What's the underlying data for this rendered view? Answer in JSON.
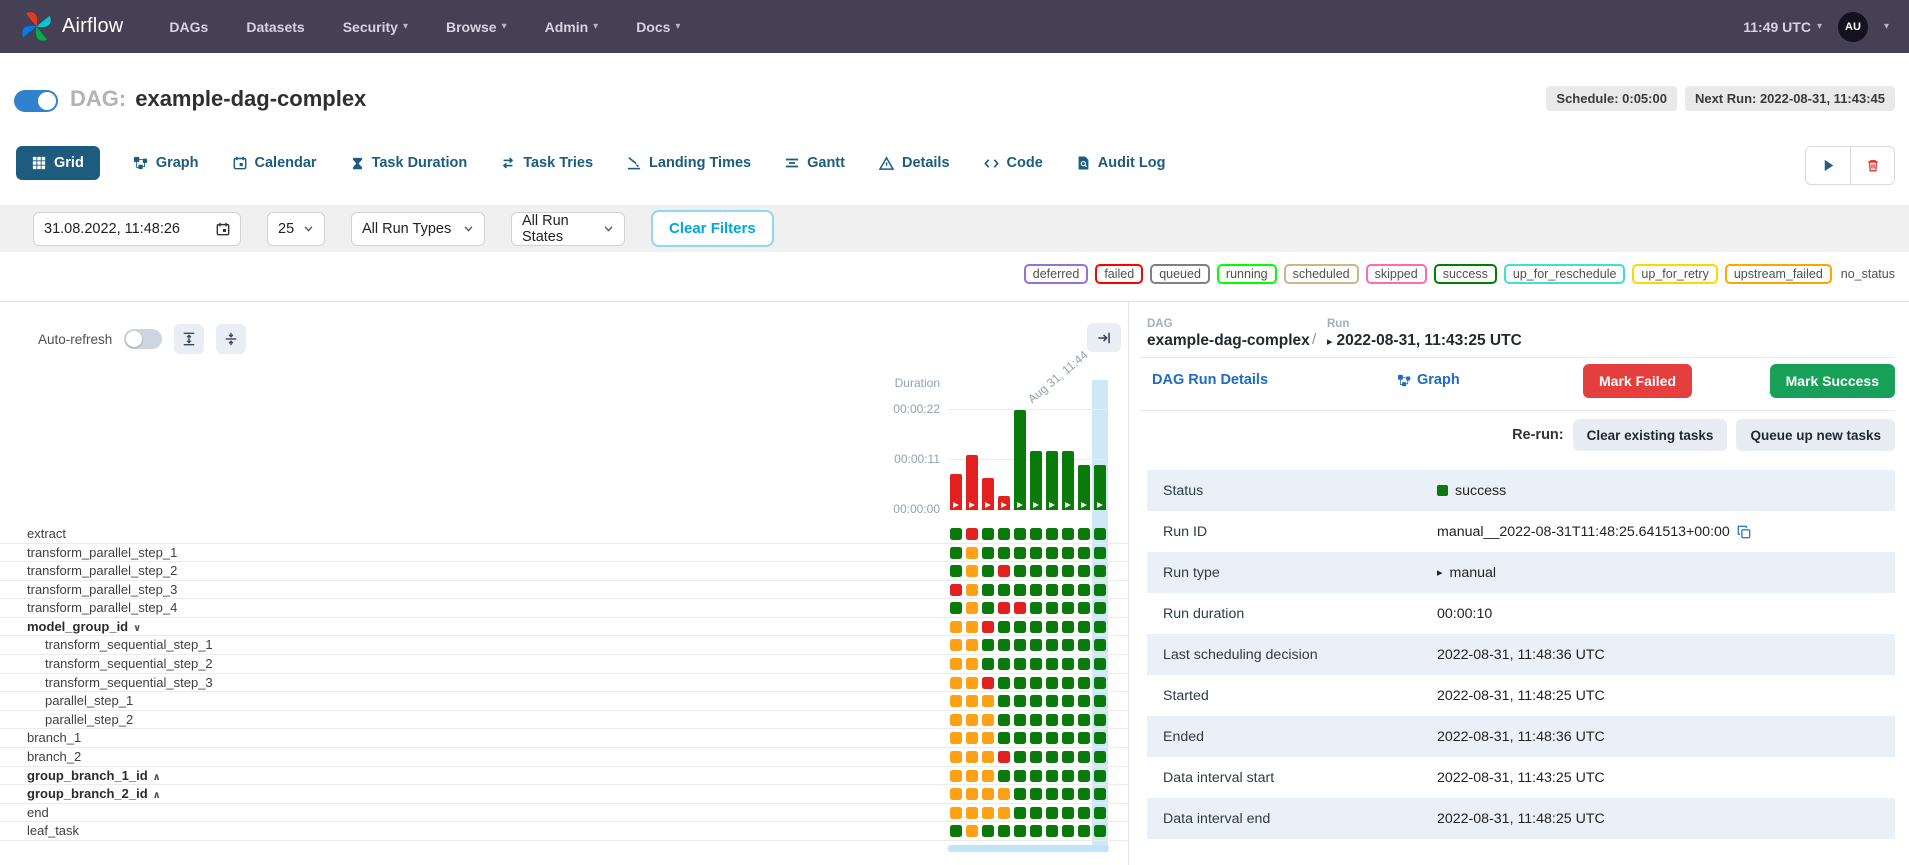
{
  "navbar": {
    "brand": "Airflow",
    "items": [
      {
        "label": "DAGs",
        "dropdown": false
      },
      {
        "label": "Datasets",
        "dropdown": false
      },
      {
        "label": "Security",
        "dropdown": true
      },
      {
        "label": "Browse",
        "dropdown": true
      },
      {
        "label": "Admin",
        "dropdown": true
      },
      {
        "label": "Docs",
        "dropdown": true
      }
    ],
    "clock": "11:49 UTC",
    "avatar_initials": "AU"
  },
  "header": {
    "dag_prefix": "DAG:",
    "dag_title": "example-dag-complex",
    "schedule_badge": "Schedule: 0:05:00",
    "next_run_badge": "Next Run: 2022-08-31, 11:43:45",
    "dag_enabled": true
  },
  "tabs": [
    {
      "label": "Grid",
      "icon": "grid-icon",
      "active": true
    },
    {
      "label": "Graph",
      "icon": "graph-icon",
      "active": false
    },
    {
      "label": "Calendar",
      "icon": "calendar-icon",
      "active": false
    },
    {
      "label": "Task Duration",
      "icon": "hourglass-icon",
      "active": false
    },
    {
      "label": "Task Tries",
      "icon": "retry-icon",
      "active": false
    },
    {
      "label": "Landing Times",
      "icon": "landing-icon",
      "active": false
    },
    {
      "label": "Gantt",
      "icon": "gantt-icon",
      "active": false
    },
    {
      "label": "Details",
      "icon": "details-icon",
      "active": false
    },
    {
      "label": "Code",
      "icon": "code-icon",
      "active": false
    },
    {
      "label": "Audit Log",
      "icon": "audit-icon",
      "active": false
    }
  ],
  "toolbar": {
    "run_icon": "play-icon",
    "delete_icon": "trash-icon"
  },
  "filters": {
    "base_date": "31.08.2022, 11:48:26",
    "num_runs": "25",
    "run_type": "All Run Types",
    "run_state": "All Run States",
    "clear_label": "Clear Filters"
  },
  "legend": {
    "items": [
      {
        "label": "deferred",
        "color": "#9370DB"
      },
      {
        "label": "failed",
        "color": "#FF0000"
      },
      {
        "label": "queued",
        "color": "#808080"
      },
      {
        "label": "running",
        "color": "#00FF00"
      },
      {
        "label": "scheduled",
        "color": "#D2B48C"
      },
      {
        "label": "skipped",
        "color": "#FF69B4"
      },
      {
        "label": "success",
        "color": "#008000"
      },
      {
        "label": "up_for_reschedule",
        "color": "#40E0D0"
      },
      {
        "label": "up_for_retry",
        "color": "#FFD700"
      },
      {
        "label": "upstream_failed",
        "color": "#FFA500"
      },
      {
        "label": "no_status",
        "color": null
      }
    ]
  },
  "grid_panel": {
    "auto_refresh_label": "Auto-refresh",
    "selected_run_index": 9
  },
  "chart_data": {
    "type": "bar",
    "title": "Duration",
    "ylabel": "Duration",
    "yticks": [
      "00:00:00",
      "00:00:11",
      "00:00:22"
    ],
    "ylim_seconds": [
      0,
      22
    ],
    "x_axis_label": "Aug 31, 11:44",
    "runs": [
      {
        "duration_seconds": 8,
        "state": "failed"
      },
      {
        "duration_seconds": 12,
        "state": "failed"
      },
      {
        "duration_seconds": 7,
        "state": "failed"
      },
      {
        "duration_seconds": 3,
        "state": "failed"
      },
      {
        "duration_seconds": 22,
        "state": "success"
      },
      {
        "duration_seconds": 13,
        "state": "success"
      },
      {
        "duration_seconds": 13,
        "state": "success"
      },
      {
        "duration_seconds": 13,
        "state": "success"
      },
      {
        "duration_seconds": 10,
        "state": "success"
      },
      {
        "duration_seconds": 10,
        "state": "success"
      }
    ]
  },
  "state_colors": {
    "success": "#0a7a0a",
    "failed": "#e32020",
    "upstream_failed": "#ffa115"
  },
  "tasks": [
    {
      "name": "extract",
      "indent": false,
      "group": null,
      "states": [
        "success",
        "failed",
        "success",
        "success",
        "success",
        "success",
        "success",
        "success",
        "success",
        "success"
      ]
    },
    {
      "name": "transform_parallel_step_1",
      "indent": false,
      "group": null,
      "states": [
        "success",
        "upstream_failed",
        "success",
        "success",
        "success",
        "success",
        "success",
        "success",
        "success",
        "success"
      ]
    },
    {
      "name": "transform_parallel_step_2",
      "indent": false,
      "group": null,
      "states": [
        "success",
        "upstream_failed",
        "success",
        "failed",
        "success",
        "success",
        "success",
        "success",
        "success",
        "success"
      ]
    },
    {
      "name": "transform_parallel_step_3",
      "indent": false,
      "group": null,
      "states": [
        "failed",
        "upstream_failed",
        "success",
        "success",
        "success",
        "success",
        "success",
        "success",
        "success",
        "success"
      ]
    },
    {
      "name": "transform_parallel_step_4",
      "indent": false,
      "group": null,
      "states": [
        "success",
        "upstream_failed",
        "success",
        "failed",
        "failed",
        "success",
        "success",
        "success",
        "success",
        "success"
      ]
    },
    {
      "name": "model_group_id",
      "indent": false,
      "group": "expanded",
      "states": [
        "upstream_failed",
        "upstream_failed",
        "failed",
        "success",
        "success",
        "success",
        "success",
        "success",
        "success",
        "success"
      ]
    },
    {
      "name": "transform_sequential_step_1",
      "indent": true,
      "group": null,
      "states": [
        "upstream_failed",
        "upstream_failed",
        "success",
        "success",
        "success",
        "success",
        "success",
        "success",
        "success",
        "success"
      ]
    },
    {
      "name": "transform_sequential_step_2",
      "indent": true,
      "group": null,
      "states": [
        "upstream_failed",
        "upstream_failed",
        "success",
        "success",
        "success",
        "success",
        "success",
        "success",
        "success",
        "success"
      ]
    },
    {
      "name": "transform_sequential_step_3",
      "indent": true,
      "group": null,
      "states": [
        "upstream_failed",
        "upstream_failed",
        "failed",
        "success",
        "success",
        "success",
        "success",
        "success",
        "success",
        "success"
      ]
    },
    {
      "name": "parallel_step_1",
      "indent": true,
      "group": null,
      "states": [
        "upstream_failed",
        "upstream_failed",
        "upstream_failed",
        "success",
        "success",
        "success",
        "success",
        "success",
        "success",
        "success"
      ]
    },
    {
      "name": "parallel_step_2",
      "indent": true,
      "group": null,
      "states": [
        "upstream_failed",
        "upstream_failed",
        "upstream_failed",
        "success",
        "success",
        "success",
        "success",
        "success",
        "success",
        "success"
      ]
    },
    {
      "name": "branch_1",
      "indent": false,
      "group": null,
      "states": [
        "upstream_failed",
        "upstream_failed",
        "upstream_failed",
        "success",
        "success",
        "success",
        "success",
        "success",
        "success",
        "success"
      ]
    },
    {
      "name": "branch_2",
      "indent": false,
      "group": null,
      "states": [
        "upstream_failed",
        "upstream_failed",
        "upstream_failed",
        "failed",
        "success",
        "success",
        "success",
        "success",
        "success",
        "success"
      ]
    },
    {
      "name": "group_branch_1_id",
      "indent": false,
      "group": "collapsed",
      "states": [
        "upstream_failed",
        "upstream_failed",
        "upstream_failed",
        "success",
        "success",
        "success",
        "success",
        "success",
        "success",
        "success"
      ]
    },
    {
      "name": "group_branch_2_id",
      "indent": false,
      "group": "collapsed",
      "states": [
        "upstream_failed",
        "upstream_failed",
        "upstream_failed",
        "upstream_failed",
        "success",
        "success",
        "success",
        "success",
        "success",
        "success"
      ]
    },
    {
      "name": "end",
      "indent": false,
      "group": null,
      "states": [
        "upstream_failed",
        "upstream_failed",
        "upstream_failed",
        "upstream_failed",
        "success",
        "success",
        "success",
        "success",
        "success",
        "success"
      ]
    },
    {
      "name": "leaf_task",
      "indent": false,
      "group": null,
      "states": [
        "success",
        "upstream_failed",
        "success",
        "success",
        "success",
        "success",
        "success",
        "success",
        "success",
        "success"
      ]
    }
  ],
  "details": {
    "breadcrumb": {
      "dag_label": "DAG",
      "dag_value": "example-dag-complex",
      "separator": "/",
      "run_label": "Run",
      "run_value": "2022-08-31, 11:43:25 UTC"
    },
    "links": {
      "dag_run_details": "DAG Run Details",
      "graph": "Graph"
    },
    "mark_failed": "Mark Failed",
    "mark_success": "Mark Success",
    "rerun_label": "Re-run:",
    "rerun_buttons": [
      "Clear existing tasks",
      "Queue up new tasks"
    ],
    "table": [
      {
        "label": "Status",
        "value": "success",
        "kind": "status"
      },
      {
        "label": "Run ID",
        "value": "manual__2022-08-31T11:48:25.641513+00:00",
        "kind": "copy"
      },
      {
        "label": "Run type",
        "value": "manual",
        "kind": "manual"
      },
      {
        "label": "Run duration",
        "value": "00:00:10",
        "kind": "text"
      },
      {
        "label": "Last scheduling decision",
        "value": "2022-08-31, 11:48:36 UTC",
        "kind": "text"
      },
      {
        "label": "Started",
        "value": "2022-08-31, 11:48:25 UTC",
        "kind": "text"
      },
      {
        "label": "Ended",
        "value": "2022-08-31, 11:48:36 UTC",
        "kind": "text"
      },
      {
        "label": "Data interval start",
        "value": "2022-08-31, 11:43:25 UTC",
        "kind": "text"
      },
      {
        "label": "Data interval end",
        "value": "2022-08-31, 11:48:25 UTC",
        "kind": "text"
      }
    ]
  },
  "colors": {
    "navbar_bg": "#454053",
    "tab_active_blue": "#1d5b7f",
    "link_blue": "#1f6ac6",
    "mark_failed_red": "#e53e3e",
    "mark_success_green": "#18a058",
    "selected_column_highlight": "#cfe8f8",
    "table_stripe": "#e9f0f8",
    "clear_filters_blue": "#00a7e1"
  }
}
